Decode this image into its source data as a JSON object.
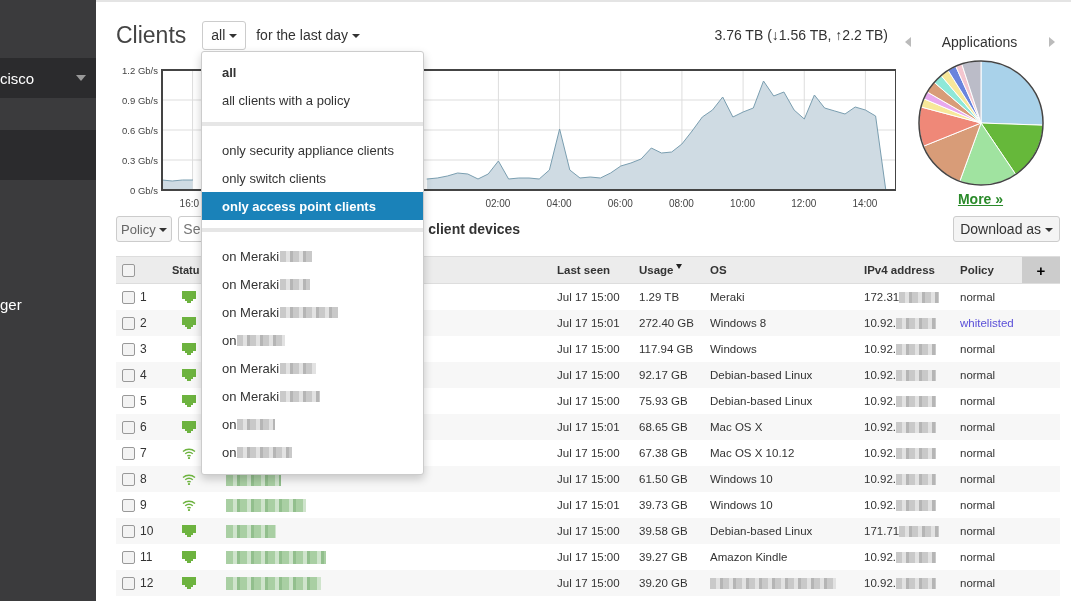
{
  "sidebar": {
    "items": [
      {
        "label": "cisco",
        "kind": "dropdown"
      },
      {
        "kind": "blank"
      },
      {
        "label": "ger",
        "kind": "link"
      }
    ]
  },
  "header": {
    "title": "Clients",
    "filter": "all",
    "period": "for the last day",
    "totals": "3.76 TB (↓1.56 TB, ↑2.2 TB)"
  },
  "chart_data": {
    "type": "area",
    "grid": true,
    "ylim": [
      0,
      1.2
    ],
    "yticks": [
      {
        "value": 0,
        "label": "0 Gb/s"
      },
      {
        "value": 0.3,
        "label": "0.3 Gb/s"
      },
      {
        "value": 0.6,
        "label": "0.6 Gb/s"
      },
      {
        "value": 0.9,
        "label": "0.9 Gb/s"
      },
      {
        "value": 1.2,
        "label": "1.2 Gb/s"
      }
    ],
    "categories": [
      null,
      null,
      null,
      "16:0",
      null,
      null,
      null,
      null,
      null,
      null,
      null,
      null,
      null,
      null,
      null,
      null,
      null,
      null,
      null,
      null,
      null,
      null,
      null,
      null,
      null,
      null,
      null,
      null,
      null,
      null,
      null,
      null,
      null,
      "02:00",
      null,
      null,
      null,
      null,
      null,
      "04:00",
      null,
      null,
      null,
      null,
      null,
      "06:00",
      null,
      null,
      null,
      null,
      null,
      "08:00",
      null,
      null,
      null,
      null,
      null,
      "10:00",
      null,
      null,
      null,
      null,
      null,
      "12:00",
      null,
      null,
      null,
      null,
      null,
      "14:00",
      null,
      null,
      null
    ],
    "series": [
      {
        "color": "#7a9eb0",
        "values": [
          0.1,
          0.09,
          0.1,
          0.1,
          null,
          null,
          null,
          null,
          null,
          null,
          null,
          null,
          null,
          null,
          null,
          null,
          null,
          null,
          null,
          null,
          null,
          null,
          null,
          null,
          null,
          null,
          0.11,
          0.12,
          0.14,
          0.17,
          0.16,
          0.11,
          0.16,
          0.29,
          0.11,
          0.12,
          0.12,
          0.11,
          0.2,
          0.61,
          0.2,
          0.12,
          0.13,
          0.12,
          0.17,
          0.24,
          0.27,
          0.31,
          0.42,
          0.37,
          0.38,
          0.46,
          0.59,
          0.73,
          0.8,
          0.93,
          0.73,
          0.78,
          0.82,
          1.09,
          0.94,
          0.98,
          0.8,
          0.71,
          0.95,
          0.82,
          0.79,
          0.76,
          0.83,
          0.8,
          0.74,
          0,
          null
        ]
      }
    ]
  },
  "applications": {
    "title": "Applications",
    "more": "More »"
  },
  "toolbar": {
    "policy": "Policy",
    "search_placeholder": "Se",
    "caption": "client devices",
    "download": "Download as"
  },
  "table": {
    "all_checked": false,
    "status_column": "Statu",
    "columns": [
      {
        "label": "Last seen",
        "sorted": false
      },
      {
        "label": "Usage",
        "sorted": true
      },
      {
        "label": "OS",
        "sorted": false
      },
      {
        "label": "IPv4 address",
        "sorted": false
      },
      {
        "label": "Policy",
        "sorted": false
      }
    ],
    "add_column": "+",
    "rows": [
      {
        "checked": false,
        "num": "1",
        "kind": "wired",
        "last_seen": "Jul 17 15:00",
        "usage": "1.29 TB",
        "os": "Meraki",
        "ip": "172.31",
        "policy": "normal",
        "policy_link": false
      },
      {
        "checked": false,
        "num": "2",
        "kind": "wired",
        "last_seen": "Jul 17 15:01",
        "usage": "272.40 GB",
        "os": "Windows 8",
        "ip": "10.92.",
        "policy": "whitelisted",
        "policy_link": true
      },
      {
        "checked": false,
        "num": "3",
        "kind": "wired",
        "last_seen": "Jul 17 15:00",
        "usage": "117.94 GB",
        "os": "Windows",
        "ip": "10.92.",
        "policy": "normal",
        "policy_link": false
      },
      {
        "checked": false,
        "num": "4",
        "kind": "wired",
        "last_seen": "Jul 17 15:00",
        "usage": "92.17 GB",
        "os": "Debian-based Linux",
        "ip": "10.92.",
        "policy": "normal",
        "policy_link": false
      },
      {
        "checked": false,
        "num": "5",
        "kind": "wired",
        "last_seen": "Jul 17 15:00",
        "usage": "75.93 GB",
        "os": "Debian-based Linux",
        "ip": "10.92.",
        "policy": "normal",
        "policy_link": false
      },
      {
        "checked": false,
        "num": "6",
        "kind": "wired",
        "last_seen": "Jul 17 15:01",
        "usage": "68.65 GB",
        "os": "Mac OS X",
        "ip": "10.92.",
        "policy": "normal",
        "policy_link": false
      },
      {
        "checked": false,
        "num": "7",
        "kind": "wireless",
        "last_seen": "Jul 17 15:00",
        "usage": "67.38 GB",
        "os": "Mac OS X 10.12",
        "ip": "10.92.",
        "policy": "normal",
        "policy_link": false
      },
      {
        "checked": false,
        "num": "8",
        "kind": "wireless",
        "name_redacted": true,
        "last_seen": "Jul 17 15:00",
        "usage": "61.50 GB",
        "os": "Windows 10",
        "ip": "10.92.",
        "policy": "normal",
        "policy_link": false
      },
      {
        "checked": false,
        "num": "9",
        "kind": "wireless",
        "name_redacted": true,
        "last_seen": "Jul 17 15:01",
        "usage": "39.73 GB",
        "os": "Windows 10",
        "ip": "10.92.",
        "policy": "normal",
        "policy_link": false
      },
      {
        "checked": false,
        "num": "10",
        "kind": "wired",
        "name_redacted": true,
        "last_seen": "Jul 17 15:00",
        "usage": "39.58 GB",
        "os": "Debian-based Linux",
        "ip": "171.71",
        "policy": "normal",
        "policy_link": false
      },
      {
        "checked": false,
        "num": "11",
        "kind": "wired",
        "name_redacted": true,
        "last_seen": "Jul 17 15:00",
        "usage": "39.27 GB",
        "os": "Amazon Kindle",
        "ip": "10.92.",
        "policy": "normal",
        "policy_link": false
      },
      {
        "checked": false,
        "num": "12",
        "kind": "wired",
        "name_redacted": true,
        "last_seen": "Jul 17 15:00",
        "usage": "39.20 GB",
        "os_redacted": true,
        "ip": "10.92.",
        "policy": "normal",
        "policy_link": false
      }
    ]
  },
  "menu": {
    "items": [
      {
        "kind": "option",
        "label": "all",
        "current": true,
        "selected": false,
        "redacted": false
      },
      {
        "kind": "option",
        "label": "all clients with a policy",
        "current": false,
        "selected": false,
        "redacted": false
      },
      {
        "kind": "divider"
      },
      {
        "kind": "option",
        "label": "only security appliance clients",
        "current": false,
        "selected": false,
        "redacted": false
      },
      {
        "kind": "option",
        "label": "only switch clients",
        "current": false,
        "selected": false,
        "redacted": false
      },
      {
        "kind": "option",
        "label": "only access point clients",
        "current": false,
        "selected": true,
        "redacted": false
      },
      {
        "kind": "divider"
      },
      {
        "kind": "option",
        "label": "on Meraki",
        "current": false,
        "selected": false,
        "redacted": true
      },
      {
        "kind": "option",
        "label": "on Meraki",
        "current": false,
        "selected": false,
        "redacted": true
      },
      {
        "kind": "option",
        "label": "on Meraki",
        "current": false,
        "selected": false,
        "redacted": true
      },
      {
        "kind": "option",
        "label": "on",
        "current": false,
        "selected": false,
        "redacted": true
      },
      {
        "kind": "option",
        "label": "on Meraki",
        "current": false,
        "selected": false,
        "redacted": true
      },
      {
        "kind": "option",
        "label": "on Meraki",
        "current": false,
        "selected": false,
        "redacted": true
      },
      {
        "kind": "option",
        "label": "on",
        "current": false,
        "selected": false,
        "redacted": true
      },
      {
        "kind": "option",
        "label": "on",
        "current": false,
        "selected": false,
        "redacted": true
      }
    ]
  }
}
